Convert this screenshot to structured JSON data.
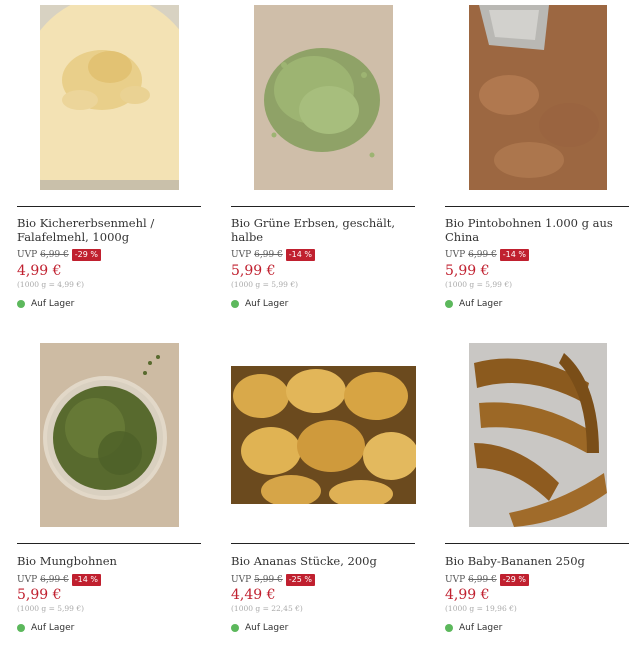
{
  "products": [
    {
      "name": "Bio Kichererbsenmehl / Falafelmehl, 1000g",
      "uvp_label": "UVP",
      "old_price": "6,99 €",
      "discount": "-29 %",
      "price": "4,99 €",
      "unit_price": "(1000 g = 4,99 €)",
      "stock": "Auf Lager",
      "image": "chickpea-flour-image"
    },
    {
      "name": "Bio Grüne Erbsen, geschält, halbe",
      "uvp_label": "UVP",
      "old_price": "6,99 €",
      "discount": "-14 %",
      "price": "5,99 €",
      "unit_price": "(1000 g = 5,99 €)",
      "stock": "Auf Lager",
      "image": "green-peas-image"
    },
    {
      "name": "Bio Pintobohnen 1.000 g aus China",
      "uvp_label": "UVP",
      "old_price": "6,99 €",
      "discount": "-14 %",
      "price": "5,99 €",
      "unit_price": "(1000 g = 5,99 €)",
      "stock": "Auf Lager",
      "image": "pinto-beans-image"
    },
    {
      "name": "Bio Mungbohnen",
      "uvp_label": "UVP",
      "old_price": "6,99 €",
      "discount": "-14 %",
      "price": "5,99 €",
      "unit_price": "(1000 g = 5,99 €)",
      "stock": "Auf Lager",
      "image": "mung-beans-image"
    },
    {
      "name": "Bio Ananas Stücke, 200g",
      "uvp_label": "UVP",
      "old_price": "5,99 €",
      "discount": "-25 %",
      "price": "4,49 €",
      "unit_price": "(1000 g = 22,45 €)",
      "stock": "Auf Lager",
      "image": "pineapple-pieces-image"
    },
    {
      "name": "Bio Baby-Bananen 250g",
      "uvp_label": "UVP",
      "old_price": "6,99 €",
      "discount": "-29 %",
      "price": "4,99 €",
      "unit_price": "(1000 g = 19,96 €)",
      "stock": "Auf Lager",
      "image": "baby-bananas-image"
    }
  ],
  "colors": {
    "price": "#c0202f",
    "badge": "#c0202f",
    "in_stock": "#5cb85c"
  }
}
